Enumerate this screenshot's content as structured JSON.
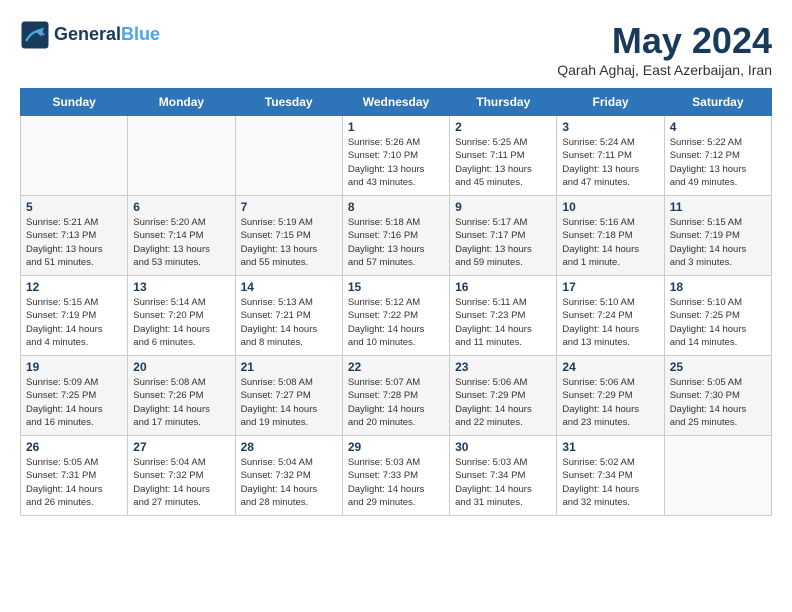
{
  "header": {
    "logo_line1": "General",
    "logo_line2": "Blue",
    "month_title": "May 2024",
    "subtitle": "Qarah Aghaj, East Azerbaijan, Iran"
  },
  "days_of_week": [
    "Sunday",
    "Monday",
    "Tuesday",
    "Wednesday",
    "Thursday",
    "Friday",
    "Saturday"
  ],
  "weeks": [
    [
      {
        "day": "",
        "info": ""
      },
      {
        "day": "",
        "info": ""
      },
      {
        "day": "",
        "info": ""
      },
      {
        "day": "1",
        "info": "Sunrise: 5:26 AM\nSunset: 7:10 PM\nDaylight: 13 hours\nand 43 minutes."
      },
      {
        "day": "2",
        "info": "Sunrise: 5:25 AM\nSunset: 7:11 PM\nDaylight: 13 hours\nand 45 minutes."
      },
      {
        "day": "3",
        "info": "Sunrise: 5:24 AM\nSunset: 7:11 PM\nDaylight: 13 hours\nand 47 minutes."
      },
      {
        "day": "4",
        "info": "Sunrise: 5:22 AM\nSunset: 7:12 PM\nDaylight: 13 hours\nand 49 minutes."
      }
    ],
    [
      {
        "day": "5",
        "info": "Sunrise: 5:21 AM\nSunset: 7:13 PM\nDaylight: 13 hours\nand 51 minutes."
      },
      {
        "day": "6",
        "info": "Sunrise: 5:20 AM\nSunset: 7:14 PM\nDaylight: 13 hours\nand 53 minutes."
      },
      {
        "day": "7",
        "info": "Sunrise: 5:19 AM\nSunset: 7:15 PM\nDaylight: 13 hours\nand 55 minutes."
      },
      {
        "day": "8",
        "info": "Sunrise: 5:18 AM\nSunset: 7:16 PM\nDaylight: 13 hours\nand 57 minutes."
      },
      {
        "day": "9",
        "info": "Sunrise: 5:17 AM\nSunset: 7:17 PM\nDaylight: 13 hours\nand 59 minutes."
      },
      {
        "day": "10",
        "info": "Sunrise: 5:16 AM\nSunset: 7:18 PM\nDaylight: 14 hours\nand 1 minute."
      },
      {
        "day": "11",
        "info": "Sunrise: 5:15 AM\nSunset: 7:19 PM\nDaylight: 14 hours\nand 3 minutes."
      }
    ],
    [
      {
        "day": "12",
        "info": "Sunrise: 5:15 AM\nSunset: 7:19 PM\nDaylight: 14 hours\nand 4 minutes."
      },
      {
        "day": "13",
        "info": "Sunrise: 5:14 AM\nSunset: 7:20 PM\nDaylight: 14 hours\nand 6 minutes."
      },
      {
        "day": "14",
        "info": "Sunrise: 5:13 AM\nSunset: 7:21 PM\nDaylight: 14 hours\nand 8 minutes."
      },
      {
        "day": "15",
        "info": "Sunrise: 5:12 AM\nSunset: 7:22 PM\nDaylight: 14 hours\nand 10 minutes."
      },
      {
        "day": "16",
        "info": "Sunrise: 5:11 AM\nSunset: 7:23 PM\nDaylight: 14 hours\nand 11 minutes."
      },
      {
        "day": "17",
        "info": "Sunrise: 5:10 AM\nSunset: 7:24 PM\nDaylight: 14 hours\nand 13 minutes."
      },
      {
        "day": "18",
        "info": "Sunrise: 5:10 AM\nSunset: 7:25 PM\nDaylight: 14 hours\nand 14 minutes."
      }
    ],
    [
      {
        "day": "19",
        "info": "Sunrise: 5:09 AM\nSunset: 7:25 PM\nDaylight: 14 hours\nand 16 minutes."
      },
      {
        "day": "20",
        "info": "Sunrise: 5:08 AM\nSunset: 7:26 PM\nDaylight: 14 hours\nand 17 minutes."
      },
      {
        "day": "21",
        "info": "Sunrise: 5:08 AM\nSunset: 7:27 PM\nDaylight: 14 hours\nand 19 minutes."
      },
      {
        "day": "22",
        "info": "Sunrise: 5:07 AM\nSunset: 7:28 PM\nDaylight: 14 hours\nand 20 minutes."
      },
      {
        "day": "23",
        "info": "Sunrise: 5:06 AM\nSunset: 7:29 PM\nDaylight: 14 hours\nand 22 minutes."
      },
      {
        "day": "24",
        "info": "Sunrise: 5:06 AM\nSunset: 7:29 PM\nDaylight: 14 hours\nand 23 minutes."
      },
      {
        "day": "25",
        "info": "Sunrise: 5:05 AM\nSunset: 7:30 PM\nDaylight: 14 hours\nand 25 minutes."
      }
    ],
    [
      {
        "day": "26",
        "info": "Sunrise: 5:05 AM\nSunset: 7:31 PM\nDaylight: 14 hours\nand 26 minutes."
      },
      {
        "day": "27",
        "info": "Sunrise: 5:04 AM\nSunset: 7:32 PM\nDaylight: 14 hours\nand 27 minutes."
      },
      {
        "day": "28",
        "info": "Sunrise: 5:04 AM\nSunset: 7:32 PM\nDaylight: 14 hours\nand 28 minutes."
      },
      {
        "day": "29",
        "info": "Sunrise: 5:03 AM\nSunset: 7:33 PM\nDaylight: 14 hours\nand 29 minutes."
      },
      {
        "day": "30",
        "info": "Sunrise: 5:03 AM\nSunset: 7:34 PM\nDaylight: 14 hours\nand 31 minutes."
      },
      {
        "day": "31",
        "info": "Sunrise: 5:02 AM\nSunset: 7:34 PM\nDaylight: 14 hours\nand 32 minutes."
      },
      {
        "day": "",
        "info": ""
      }
    ]
  ]
}
